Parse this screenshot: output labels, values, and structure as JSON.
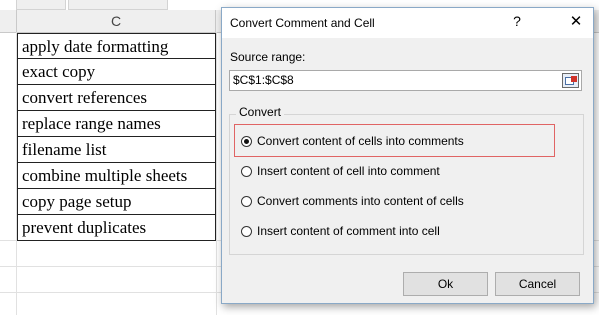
{
  "spreadsheet": {
    "column_header": "C",
    "cells": [
      "apply date formatting",
      "exact copy",
      "convert references",
      "replace range names",
      "filename list",
      "combine multiple sheets",
      "copy page setup",
      "prevent duplicates"
    ]
  },
  "dialog": {
    "title": "Convert Comment and Cell",
    "help_glyph": "?",
    "close_glyph": "✕",
    "source_range_label": "Source range:",
    "source_range_value": "$C$1:$C$8",
    "group_title": "Convert",
    "options": [
      {
        "label": "Convert content of cells into comments",
        "selected": true
      },
      {
        "label": "Insert content of cell into comment",
        "selected": false
      },
      {
        "label": "Convert comments into content of cells",
        "selected": false
      },
      {
        "label": "Insert content of comment into cell",
        "selected": false
      }
    ],
    "ok_label": "Ok",
    "cancel_label": "Cancel"
  },
  "colors": {
    "highlight_border": "#e06464",
    "dialog_bg": "#f0f0f0"
  }
}
